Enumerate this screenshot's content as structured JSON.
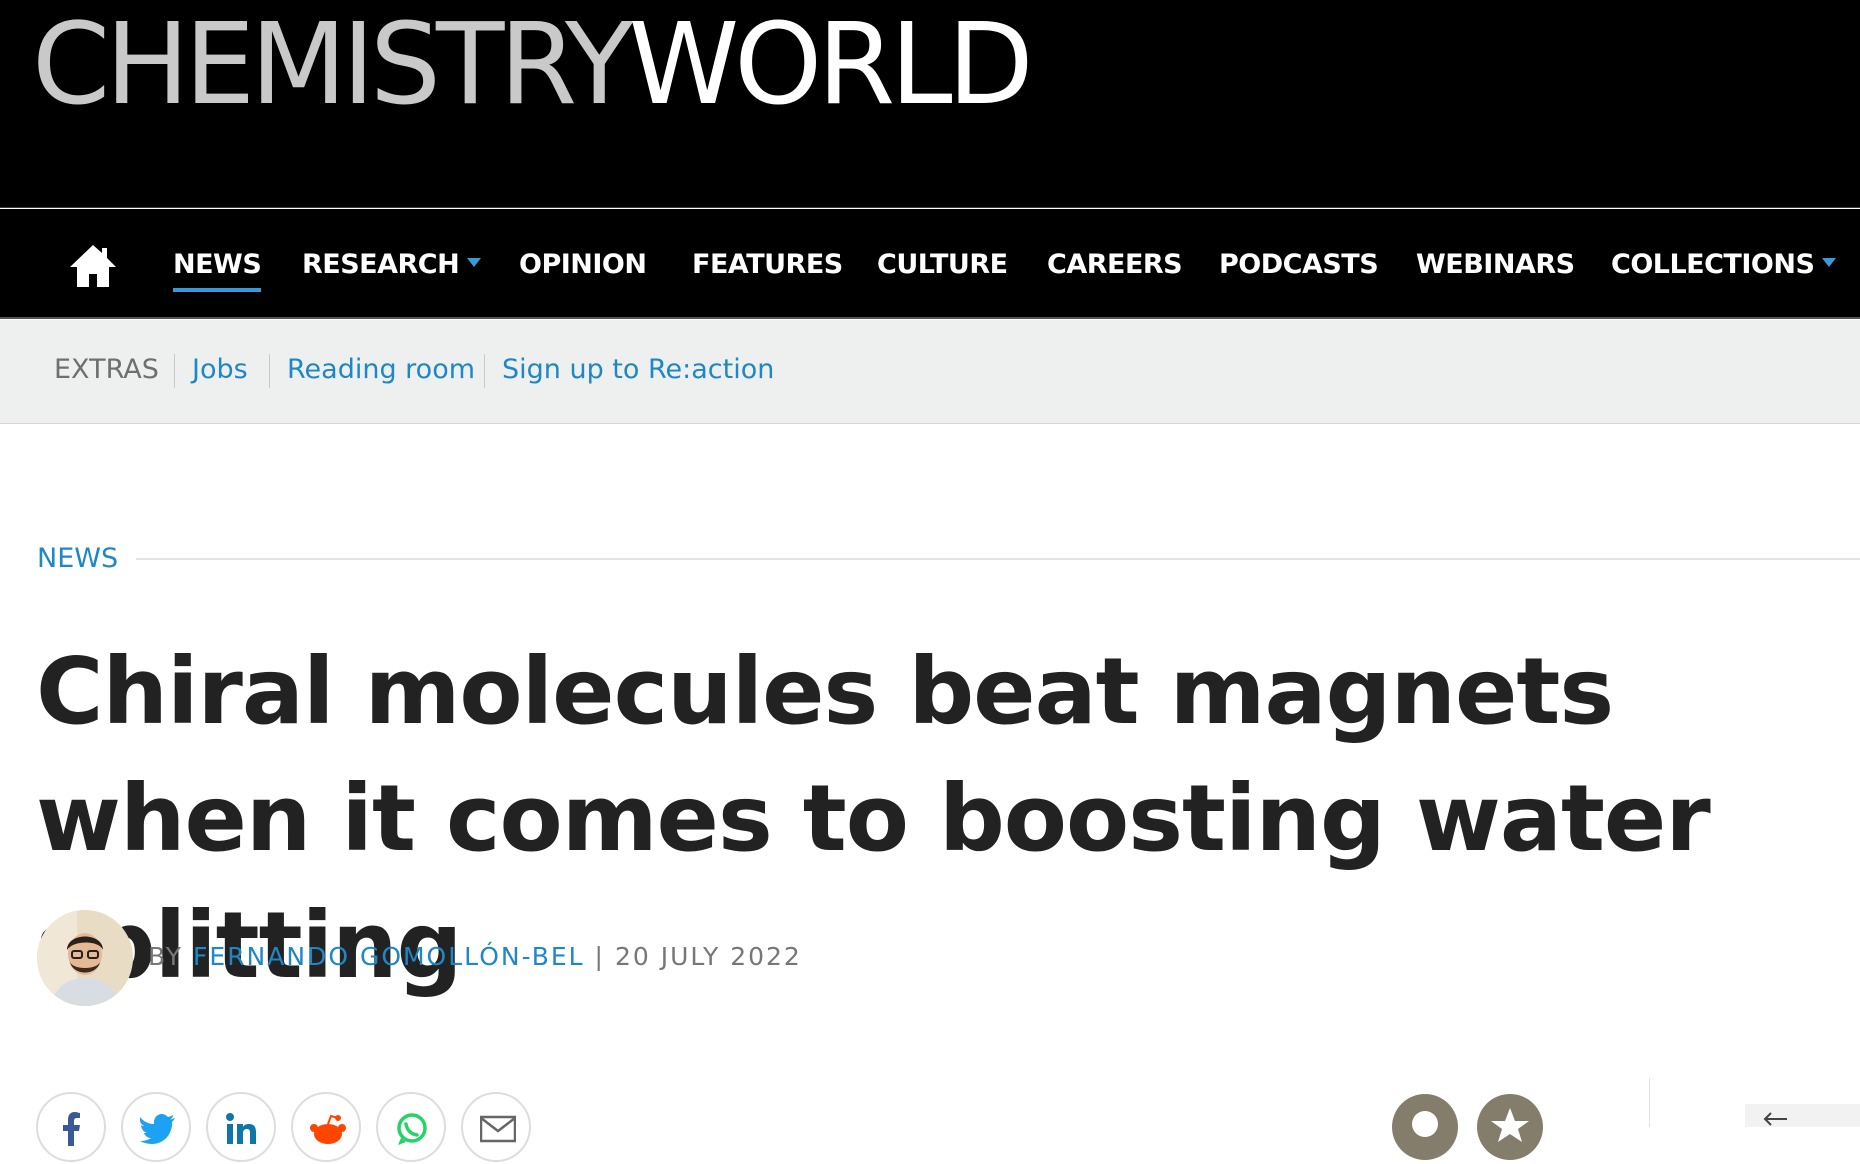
{
  "site": {
    "logo_part1": "CHEMISTRY",
    "logo_part2": "WORLD"
  },
  "main_nav": {
    "home_icon": "home-icon",
    "items": [
      {
        "label": "NEWS",
        "active": true
      },
      {
        "label": "RESEARCH",
        "dropdown": true
      },
      {
        "label": "OPINION"
      },
      {
        "label": "FEATURES"
      },
      {
        "label": "CULTURE"
      },
      {
        "label": "CAREERS"
      },
      {
        "label": "PODCASTS"
      },
      {
        "label": "WEBINARS"
      },
      {
        "label": "COLLECTIONS",
        "dropdown": true
      }
    ]
  },
  "sub_nav": {
    "label": "EXTRAS",
    "links": [
      "Jobs",
      "Reading room",
      "Sign up to Re:action"
    ]
  },
  "article": {
    "section": "NEWS",
    "headline": "Chiral molecules beat magnets when it comes to boosting water splitting",
    "byline_prefix": "BY",
    "author": "FERNANDO GOMOLLÓN-BEL",
    "separator": "|",
    "date": "20 JULY 2022"
  },
  "share": {
    "icons": [
      "facebook-icon",
      "twitter-icon",
      "linkedin-icon",
      "reddit-icon",
      "whatsapp-icon",
      "email-icon"
    ]
  },
  "colors": {
    "accent": "#1f87c6",
    "background_dark": "#000000",
    "subnav_bg": "#eef0ef",
    "headline": "#222222"
  }
}
